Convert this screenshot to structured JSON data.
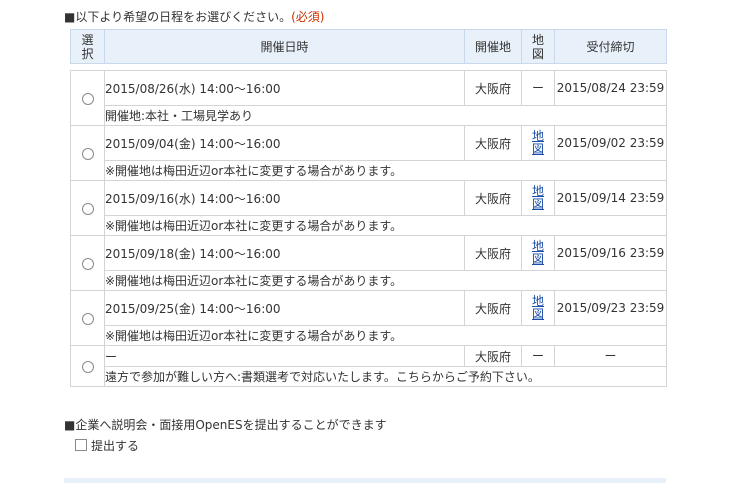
{
  "schedule_section": {
    "title": "■以下より希望の日程をお選びください。",
    "required": "(必須)"
  },
  "table": {
    "headers": {
      "select": "選択",
      "datetime": "開催日時",
      "location": "開催地",
      "map": "地図",
      "deadline": "受付締切"
    },
    "rows": [
      {
        "datetime": "2015/08/26(水)  14:00〜16:00",
        "location": "大阪府",
        "map": "ー",
        "deadline": "2015/08/24 23:59",
        "note": "開催地:本社・工場見学あり"
      },
      {
        "datetime": "2015/09/04(金)  14:00〜16:00",
        "location": "大阪府",
        "map": "地図",
        "deadline": "2015/09/02 23:59",
        "note": "※開催地は梅田近辺or本社に変更する場合があります。"
      },
      {
        "datetime": "2015/09/16(水)  14:00〜16:00",
        "location": "大阪府",
        "map": "地図",
        "deadline": "2015/09/14 23:59",
        "note": "※開催地は梅田近辺or本社に変更する場合があります。"
      },
      {
        "datetime": "2015/09/18(金)  14:00〜16:00",
        "location": "大阪府",
        "map": "地図",
        "deadline": "2015/09/16 23:59",
        "note": "※開催地は梅田近辺or本社に変更する場合があります。"
      },
      {
        "datetime": "2015/09/25(金)  14:00〜16:00",
        "location": "大阪府",
        "map": "地図",
        "deadline": "2015/09/23 23:59",
        "note": "※開催地は梅田近辺or本社に変更する場合があります。"
      },
      {
        "datetime": "ー",
        "location": "大阪府",
        "map": "ー",
        "deadline": "ー",
        "note": "遠方で参加が難しい方へ:書類選考で対応いたします。こちらからご予約下さい。"
      }
    ]
  },
  "openes_section": {
    "title": "■企業へ説明会・面接用OpenESを提出することができます",
    "checkbox_label": "提出する"
  },
  "colors": {
    "header_bg": "#e8f1fa",
    "link": "#1a4ea8",
    "required": "#cc3300"
  }
}
